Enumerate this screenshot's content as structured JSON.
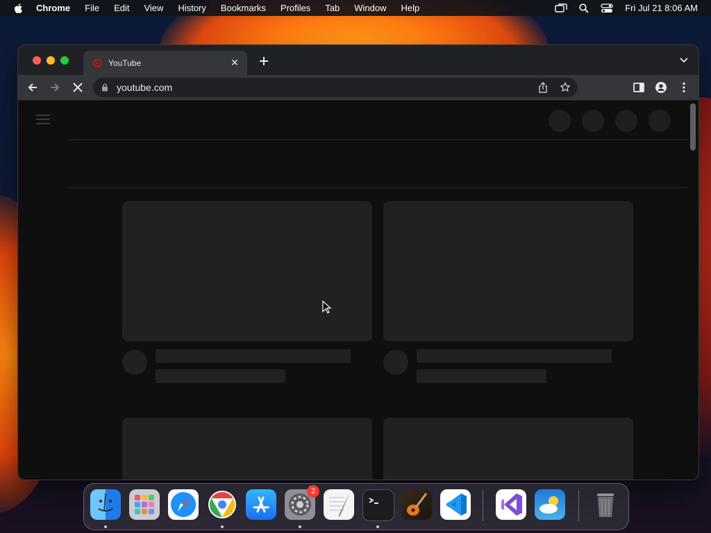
{
  "menubar": {
    "app": "Chrome",
    "items": [
      "File",
      "Edit",
      "View",
      "History",
      "Bookmarks",
      "Profiles",
      "Tab",
      "Window",
      "Help"
    ],
    "clock": "Fri Jul 21  8:06 AM"
  },
  "browser": {
    "tab_title": "YouTube",
    "url": "youtube.com"
  },
  "dock": {
    "apps": [
      "Finder",
      "Launchpad",
      "Safari",
      "Chrome",
      "App Store",
      "System Settings",
      "TextEdit",
      "Terminal",
      "GarageBand",
      "Visual Studio Code",
      "Visual Studio",
      "Weather",
      "Trash"
    ],
    "settings_badge": "2"
  },
  "colors": {
    "accent_red": "#ff3b30",
    "youtube_red": "#ff0000",
    "skeleton": "#212121"
  }
}
